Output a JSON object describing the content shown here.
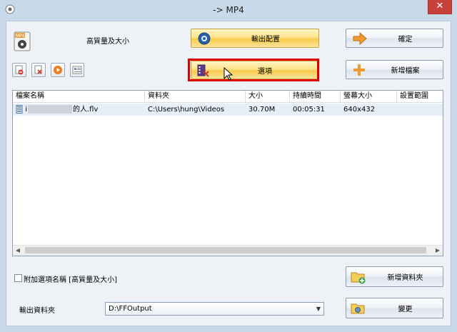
{
  "window": {
    "title": "-> MP4",
    "close_glyph": "✕"
  },
  "header": {
    "quality_label": "高質量及大小"
  },
  "buttons": {
    "output_config": "輸出配置",
    "options": "選項",
    "ok": "確定",
    "add_file": "新增檔案",
    "add_folder": "新增資料夾",
    "change": "變更"
  },
  "toolbar_icons": [
    "delete-icon",
    "clear-list-icon",
    "play-icon",
    "info-icon"
  ],
  "table": {
    "columns": [
      "檔案名稱",
      "資料夾",
      "大小",
      "持續時間",
      "螢幕大小",
      "設置範圍"
    ],
    "rows": [
      {
        "name_prefix": "i",
        "name_suffix": "的人.flv",
        "folder": "C:\\Users\\hung\\Videos",
        "size": "30.70M",
        "duration": "00:05:31",
        "screen": "640x432",
        "range": ""
      }
    ]
  },
  "options": {
    "append_name_label": "附加選項名稱 [高質量及大小]",
    "append_name_checked": false
  },
  "output": {
    "label": "輸出資料夾",
    "folder": "D:\\FFOutput"
  },
  "colors": {
    "highlight": "#e00000",
    "yellow_button": "#f6cc4c",
    "window_bg": "#c8daea"
  }
}
